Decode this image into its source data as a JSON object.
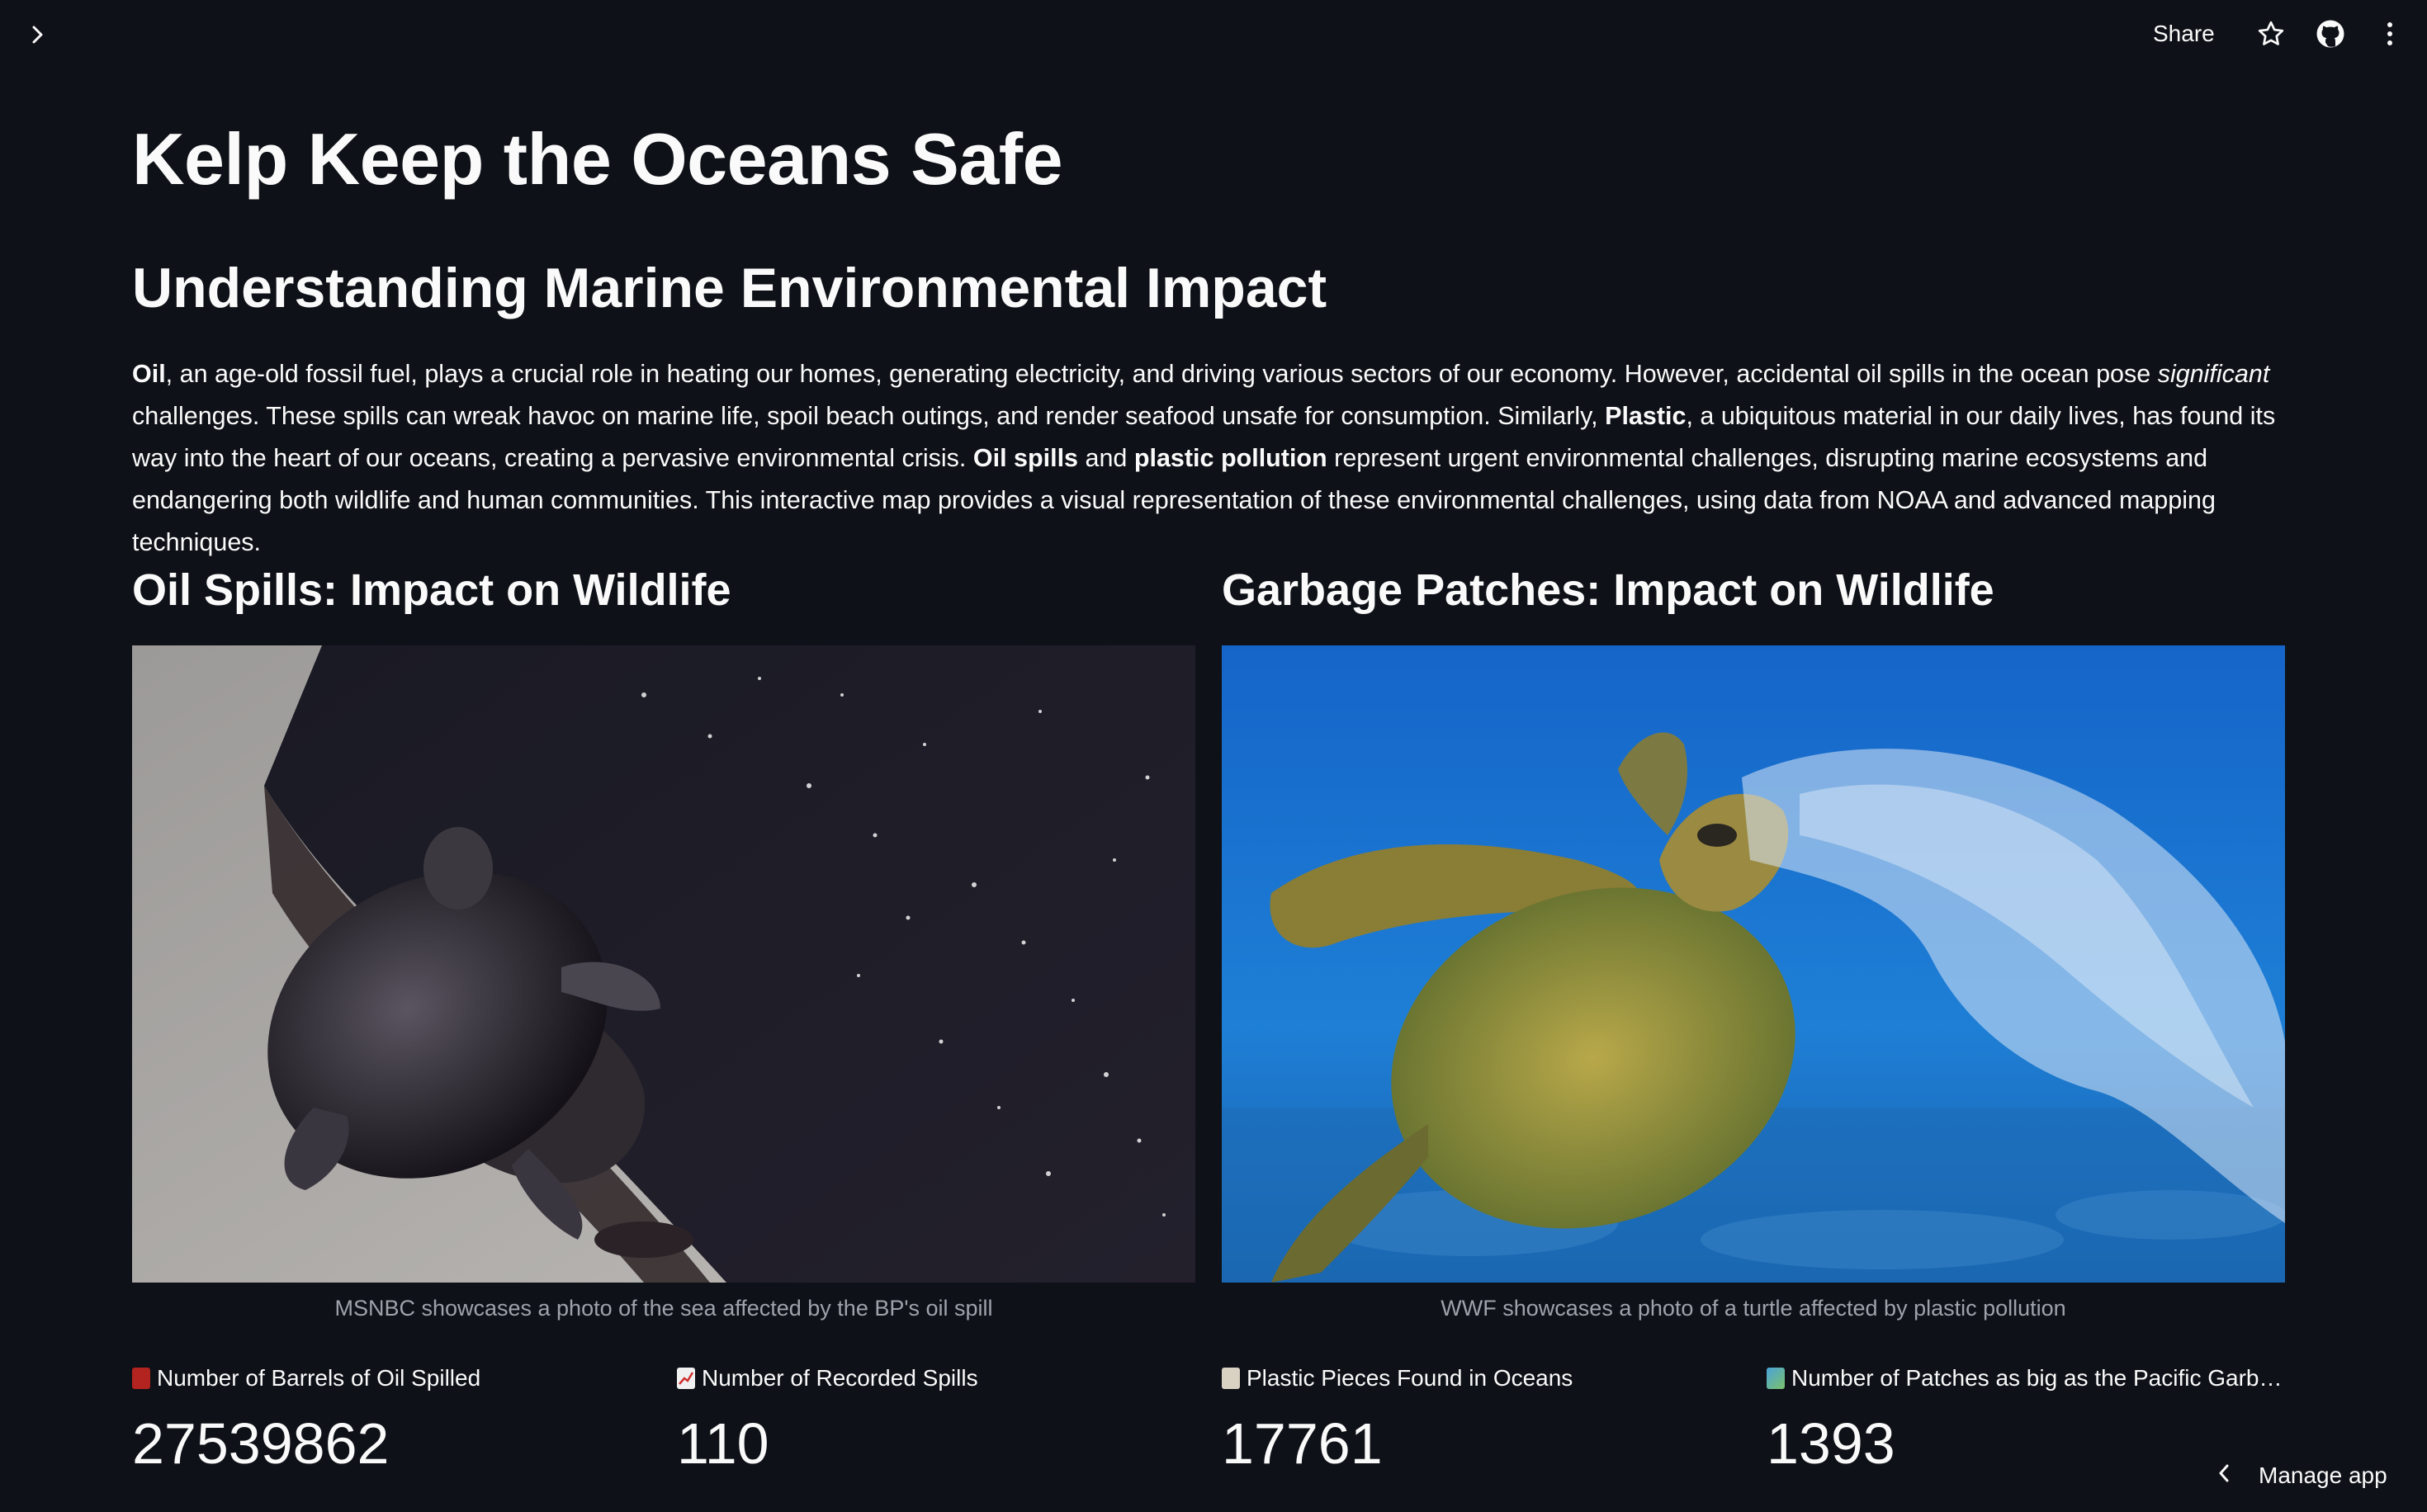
{
  "header": {
    "share_label": "Share",
    "icons": [
      "chevron-right-icon",
      "star-icon",
      "github-icon",
      "more-vertical-icon"
    ]
  },
  "main": {
    "title": "Kelp Keep the Oceans Safe",
    "subtitle": "Understanding Marine Environmental Impact",
    "intro": {
      "oil": "Oil",
      "t1": ", an age-old fossil fuel, plays a crucial role in heating our homes, generating electricity, and driving various sectors of our economy. However, accidental oil spills in the ocean pose ",
      "significant": "significant",
      "t2": " challenges. These spills can wreak havoc on marine life, spoil beach outings, and render seafood unsafe for consumption. Similarly, ",
      "plastic": "Plastic",
      "t3": ", a ubiquitous material in our daily lives, has found its way into the heart of our oceans, creating a pervasive environmental crisis. ",
      "oil_spills": "Oil spills",
      "t4": " and ",
      "plastic_pollution": "plastic pollution",
      "t5": " represent urgent environmental challenges, disrupting marine ecosystems and endangering both wildlife and human communities. This interactive map provides a visual representation of these environmental challenges, using data from NOAA and advanced mapping techniques."
    },
    "oil_section": {
      "heading": "Oil Spills: Impact on Wildlife",
      "caption": "MSNBC showcases a photo of the sea affected by the BP's oil spill",
      "metrics": [
        {
          "icon": "oil-drum-icon",
          "label": "Number of Barrels of Oil Spilled",
          "value": "27539862"
        },
        {
          "icon": "chart-increasing-icon",
          "label": "Number of Recorded Spills",
          "value": "110"
        }
      ]
    },
    "garbage_section": {
      "heading": "Garbage Patches: Impact on Wildlife",
      "caption": "WWF showcases a photo of a turtle affected by plastic pollution",
      "metrics": [
        {
          "icon": "plastic-bottle-icon",
          "label": "Plastic Pieces Found in Oceans",
          "value": "17761"
        },
        {
          "icon": "world-map-icon",
          "label": "Number of Patches as big as the Pacific Garbage Patch",
          "value": "1393"
        }
      ]
    }
  },
  "footer": {
    "manage_label": "Manage app"
  },
  "colors": {
    "background": "#0e1117",
    "text": "#fafafa",
    "caption": "#9ea3ab"
  }
}
